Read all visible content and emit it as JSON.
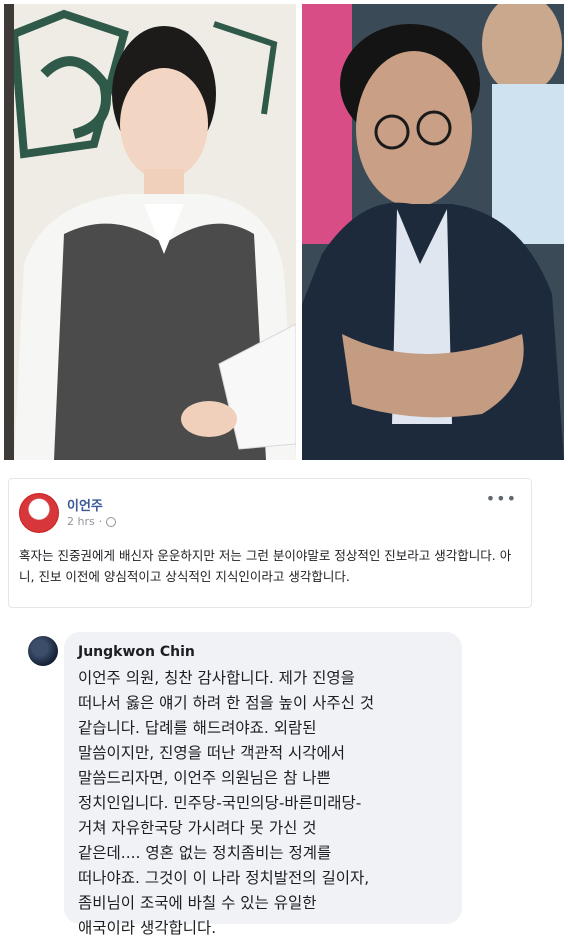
{
  "post": {
    "author": "이언주",
    "time": "2 hrs",
    "more": "•••",
    "body": "혹자는 진중권에게 배신자 운운하지만 저는 그런 분이야말로 정상적인 진보라고 생각합니다. 아니, 진보 이전에 양심적이고 상식적인 지식인이라고 생각합니다."
  },
  "comment": {
    "author": "Jungkwon Chin",
    "lines": [
      "이언주 의원, 칭찬 감사합니다. 제가 진영을",
      "떠나서 옳은 얘기 하려 한 점을 높이 사주신 것",
      "같습니다. 답례를 해드려야죠. 외람된",
      "말씀이지만, 진영을 떠난 객관적 시각에서",
      "말씀드리자면, 이언주 의원님은 참 나쁜",
      "정치인입니다. 민주당-국민의당-바른미래당-",
      "거쳐 자유한국당 가시려다 못 가신 것",
      "같은데....  영혼 없는 정치좀비는 정계를",
      "떠나야죠. 그것이 이 나라 정치발전의 길이자,",
      "좀비님이 조국에 바칠 수 있는 유일한",
      "애국이라 생각합니다."
    ]
  },
  "colors": {
    "post_author": "#385898",
    "bubble": "#f0f2f5",
    "text": "#1c1e21",
    "meta": "#90949c"
  }
}
